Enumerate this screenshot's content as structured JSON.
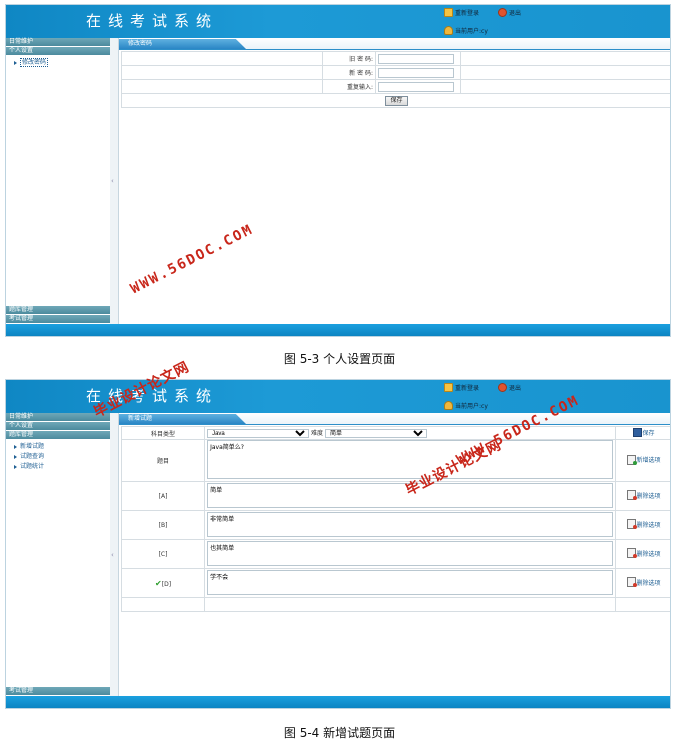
{
  "app": {
    "title": "在线考试系统",
    "top_links": {
      "relogin": "重新登录",
      "logout": "退出",
      "current_user": "当前用户:cy"
    }
  },
  "screen1": {
    "sidebar": {
      "heads_top": [
        "日常维护",
        "个人设置"
      ],
      "sub_items": [
        "修改密码"
      ],
      "heads_bottom": [
        "题库管理",
        "考试管理"
      ]
    },
    "tab_label": "修改密码",
    "form": {
      "old_password_label": "旧 密 码:",
      "new_password_label": "新 密 码:",
      "repeat_label": "重复输入:",
      "save_button": "保存"
    }
  },
  "screen2": {
    "sidebar": {
      "heads_top": [
        "日常维护",
        "个人设置",
        "题库管理"
      ],
      "sub_items": [
        "新增试题",
        "试题查询",
        "试题统计"
      ],
      "heads_bottom": [
        "考试管理"
      ]
    },
    "tab_label": "新增试题",
    "form": {
      "subject_label": "科目类型",
      "subject_value": "Java",
      "difficulty_label": "难度",
      "difficulty_value": "简单",
      "save_link": "保存",
      "question_label": "题目",
      "question_text": "Java简单么?",
      "add_option_link": "新增选项",
      "options": [
        {
          "label": "[A]",
          "text": "简单",
          "delete": "删除选项"
        },
        {
          "label": "[B]",
          "text": "非常简单",
          "delete": "删除选项"
        },
        {
          "label": "[C]",
          "text": "也其简单",
          "delete": "删除选项"
        },
        {
          "label": "[D]",
          "text": "学不会",
          "delete": "删除选项"
        }
      ]
    }
  },
  "captions": {
    "fig1": "图 5-3 个人设置页面",
    "fig2": "图 5-4 新增试题页面"
  },
  "watermarks": {
    "url": "WWW.56DOC.COM",
    "cn": "毕业设计论文网"
  }
}
